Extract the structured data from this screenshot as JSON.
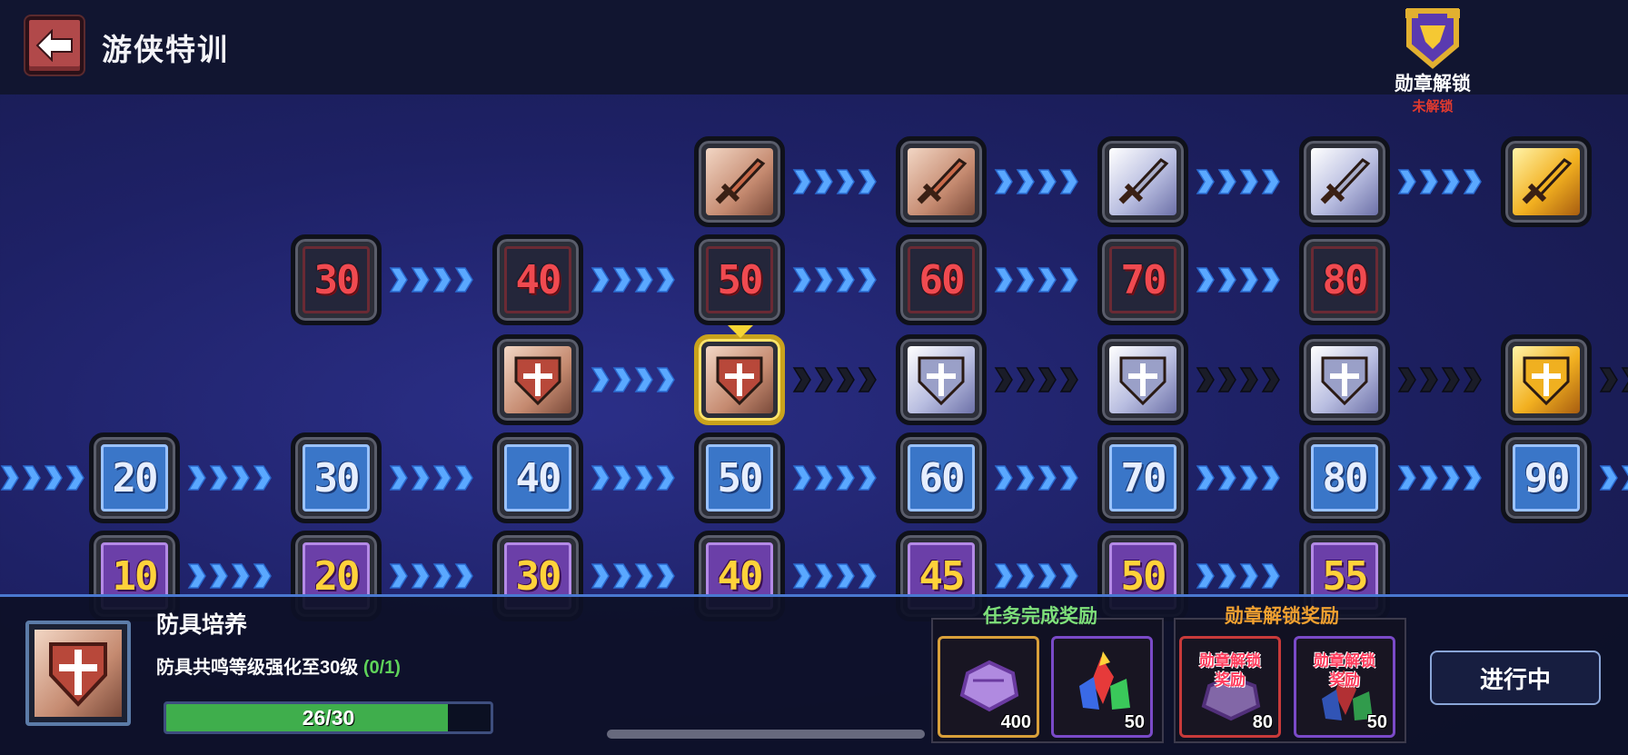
{
  "header": {
    "title": "游侠特训"
  },
  "medal_unlock": {
    "label": "勋章解锁",
    "status": "未解锁"
  },
  "grid": {
    "row_sword": [
      "bronze-sword",
      "bronze-sword",
      "silver-sword",
      "silver-sword",
      "gold-sword"
    ],
    "row_red_levels": [
      "30",
      "40",
      "50",
      "60",
      "70",
      "80"
    ],
    "row_shield": [
      "bronze-shield",
      "bronze-shield",
      "silver-shield",
      "silver-shield",
      "silver-shield",
      "gold-shield"
    ],
    "row_blue_levels": [
      "20",
      "30",
      "40",
      "50",
      "60",
      "70",
      "80",
      "90"
    ],
    "row_purple_levels": [
      "10",
      "20",
      "30",
      "40",
      "45",
      "50",
      "55"
    ]
  },
  "task": {
    "name": "防具培养",
    "description": "防具共鸣等级强化至30级",
    "progress_label": "(0/1)",
    "bar_text": "26/30",
    "bar_fraction": 0.867
  },
  "rewards": {
    "task_title": "任务完成奖励",
    "medal_title": "勋章解锁奖励",
    "task_items": [
      {
        "icon": "purple-stone-icon",
        "qty": "400"
      },
      {
        "icon": "crystal-cluster-icon",
        "qty": "50"
      }
    ],
    "medal_items": [
      {
        "icon": "purple-stone-icon",
        "locked_label": "勋章解锁奖励",
        "qty": "80"
      },
      {
        "icon": "crystal-cluster-icon",
        "locked_label": "勋章解锁奖励",
        "qty": "50"
      }
    ]
  },
  "status_button": {
    "label": "进行中"
  },
  "colors": {
    "task_title": "#7ee07a",
    "medal_title": "#f0a030",
    "progress_green": "#3fae4c",
    "unlock_red": "#e23a2e"
  }
}
